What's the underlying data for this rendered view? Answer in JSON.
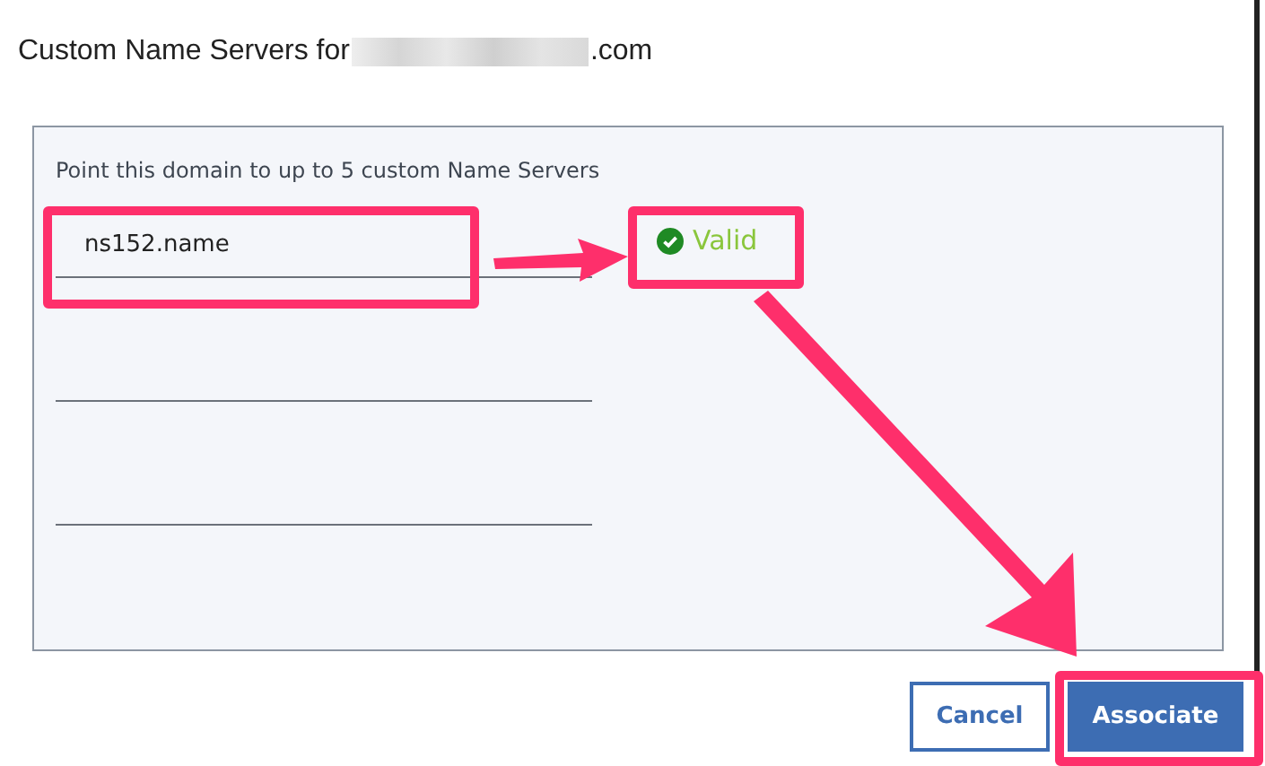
{
  "dialog": {
    "title": "Custom Name Servers for",
    "title_suffix": ".com",
    "title_redacted": true
  },
  "panel": {
    "instruction": "Point this domain to up to 5 custom Name Servers",
    "fields": [
      {
        "kind": "filled",
        "value": "ns152.name",
        "status": "Valid",
        "valid": true
      },
      {
        "kind": "empty"
      },
      {
        "kind": "empty"
      }
    ]
  },
  "buttons": [
    {
      "label": "Cancel",
      "kind": "secondary"
    },
    {
      "label": "Associate",
      "kind": "primary"
    }
  ]
}
